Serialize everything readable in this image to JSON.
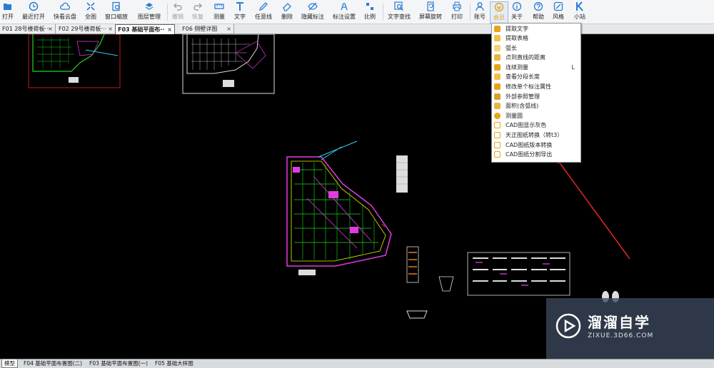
{
  "toolbar": {
    "items": [
      {
        "label": "打开",
        "icon": "folder-open-icon"
      },
      {
        "label": "最近打开",
        "icon": "clock-icon"
      },
      {
        "label": "快看云盘",
        "icon": "cloud-icon"
      },
      {
        "label": "全图",
        "icon": "fit-all-icon"
      },
      {
        "label": "窗口缩放",
        "icon": "window-zoom-icon"
      },
      {
        "label": "图层管理",
        "icon": "layers-icon"
      },
      {
        "label": "撤销",
        "icon": "undo-icon"
      },
      {
        "label": "恢复",
        "icon": "redo-icon"
      },
      {
        "label": "测量",
        "icon": "ruler-icon"
      },
      {
        "label": "文字",
        "icon": "text-icon"
      },
      {
        "label": "任意线",
        "icon": "pencil-icon"
      },
      {
        "label": "删除",
        "icon": "eraser-icon"
      },
      {
        "label": "隐藏标注",
        "icon": "eye-off-icon"
      },
      {
        "label": "标注设置",
        "icon": "annotation-settings-icon"
      },
      {
        "label": "比例",
        "icon": "scale-icon"
      },
      {
        "label": "文字查找",
        "icon": "text-search-icon"
      },
      {
        "label": "屏幕旋转",
        "icon": "rotate-screen-icon"
      },
      {
        "label": "打印",
        "icon": "printer-icon"
      },
      {
        "label": "账号",
        "icon": "user-icon"
      },
      {
        "label": "会员",
        "icon": "vip-icon"
      },
      {
        "label": "关于",
        "icon": "info-icon"
      },
      {
        "label": "帮助",
        "icon": "help-icon"
      },
      {
        "label": "风格",
        "icon": "style-icon"
      },
      {
        "label": "小站",
        "icon": "k-logo-icon"
      }
    ]
  },
  "tabs": [
    {
      "label": "F01 28号楼荷板···",
      "close": "×"
    },
    {
      "label": "F02 29号楼荷板···",
      "close": "×"
    },
    {
      "label": "F03 基础平面布··",
      "close": "×"
    },
    {
      "label": "F06 侧壁详图",
      "close": "×"
    }
  ],
  "menu": {
    "items": [
      {
        "label": "提取文字",
        "icon": "extract-text-icon",
        "shortcut": ""
      },
      {
        "label": "提取表格",
        "icon": "extract-table-icon",
        "shortcut": ""
      },
      {
        "label": "弧长",
        "icon": "arc-length-icon",
        "shortcut": ""
      },
      {
        "label": "点到直线的距离",
        "icon": "point-line-distance-icon",
        "shortcut": ""
      },
      {
        "label": "连续测量",
        "icon": "continuous-measure-icon",
        "shortcut": "L"
      },
      {
        "label": "查看分段长度",
        "icon": "segment-length-icon",
        "shortcut": ""
      },
      {
        "label": "修改单个标注属性",
        "icon": "edit-annotation-icon",
        "shortcut": ""
      },
      {
        "label": "外部参照管理",
        "icon": "xref-icon",
        "shortcut": ""
      },
      {
        "label": "面积(含弧线)",
        "icon": "area-icon",
        "shortcut": ""
      },
      {
        "label": "测量圆",
        "icon": "measure-circle-icon",
        "shortcut": ""
      },
      {
        "label": "CAD图显示灰色",
        "icon": "gray-display-icon",
        "shortcut": ""
      },
      {
        "label": "天正图纸转换（转t3）",
        "icon": "convert-t3-icon",
        "shortcut": ""
      },
      {
        "label": "CAD图纸版本转换",
        "icon": "version-convert-icon",
        "shortcut": ""
      },
      {
        "label": "CAD图纸分割导出",
        "icon": "split-export-icon",
        "shortcut": ""
      }
    ]
  },
  "bottom_tabs": [
    {
      "label": "模型"
    },
    {
      "label": "F04 基础平面布置图(二)"
    },
    {
      "label": "F03 基础平面布置图(一)"
    },
    {
      "label": "F05 基础大样图"
    }
  ],
  "watermark": {
    "title": "溜溜自学",
    "url": "ZIXUE.3D66.COM"
  },
  "colors": {
    "toolbar_icon": "#2b7bd4",
    "arrow": "#e0262b",
    "drawing_green": "#1fd51f",
    "drawing_magenta": "#e13ce0"
  }
}
